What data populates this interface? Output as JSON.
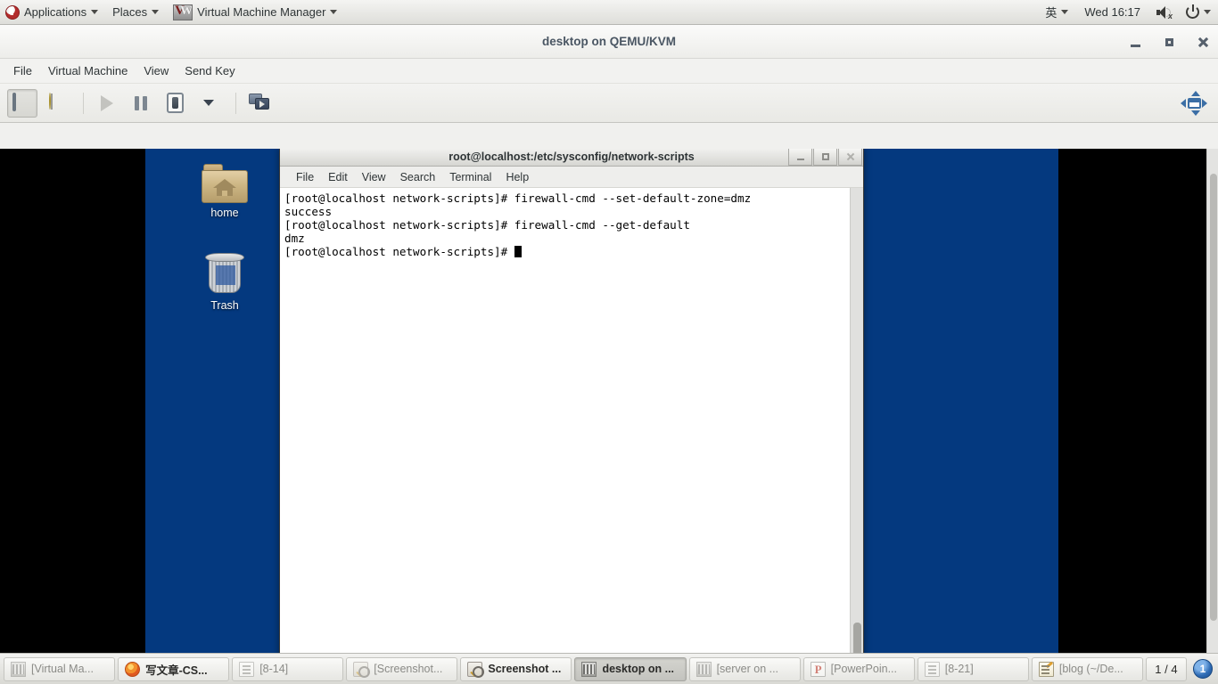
{
  "gnome_panel": {
    "menus": [
      {
        "label": "Applications",
        "icon": "fedora-logo-icon"
      },
      {
        "label": "Places",
        "icon": ""
      },
      {
        "label": "Virtual Machine Manager",
        "icon": "vmm-logo-icon"
      }
    ],
    "input_method": "英",
    "clock": "Wed 16:17",
    "volume_icon": "speaker-muted-icon",
    "power_icon": "power-icon"
  },
  "vmm_window": {
    "title": "desktop on QEMU/KVM",
    "window_buttons": {
      "minimize": "minimize",
      "maximize": "maximize",
      "close": "close"
    },
    "menus": [
      "File",
      "Virtual Machine",
      "View",
      "Send Key"
    ],
    "toolbar": [
      {
        "name": "show-console-button",
        "icon": "monitor-icon",
        "state": "active"
      },
      {
        "name": "show-details-button",
        "icon": "lightbulb-icon",
        "state": "normal"
      },
      {
        "name": "run-button",
        "icon": "play-icon",
        "state": "disabled"
      },
      {
        "name": "pause-button",
        "icon": "pause-icon",
        "state": "normal"
      },
      {
        "name": "shutdown-button",
        "icon": "shutdown-icon",
        "state": "normal"
      },
      {
        "name": "shutdown-menu-button",
        "icon": "caret-down-icon",
        "state": "normal"
      },
      {
        "name": "snapshots-button",
        "icon": "snapshots-icon",
        "state": "normal"
      }
    ],
    "resize_button_icon": "resize-to-vm-icon"
  },
  "vm_desktop": {
    "background_color": "#04397f",
    "icons": [
      {
        "label": "home",
        "icon": "home-folder-icon"
      },
      {
        "label": "Trash",
        "icon": "trash-icon"
      }
    ]
  },
  "terminal": {
    "title": "root@localhost:/etc/sysconfig/network-scripts",
    "window_buttons": {
      "minimize": "minimize",
      "maximize": "maximize",
      "close": "close"
    },
    "menus": [
      "File",
      "Edit",
      "View",
      "Search",
      "Terminal",
      "Help"
    ],
    "lines": [
      "[root@localhost network-scripts]# firewall-cmd --set-default-zone=dmz",
      "success",
      "[root@localhost network-scripts]# firewall-cmd --get-default",
      "dmz"
    ],
    "prompt": "[root@localhost network-scripts]# "
  },
  "taskbar": {
    "items": [
      {
        "label": "[Virtual Ma...",
        "icon": "vmm-window-icon",
        "active": false,
        "minimized": true
      },
      {
        "label": "写文章-CS...",
        "icon": "firefox-icon",
        "active": false,
        "minimized": false
      },
      {
        "label": "[8-14]",
        "icon": "document-icon",
        "active": false,
        "minimized": true
      },
      {
        "label": "[Screenshot...",
        "icon": "screenshot-icon",
        "active": false,
        "minimized": true
      },
      {
        "label": "Screenshot ...",
        "icon": "screenshot-icon",
        "active": true,
        "minimized": false
      },
      {
        "label": "desktop on ...",
        "icon": "vmm-window-icon",
        "active": true,
        "minimized": false
      },
      {
        "label": "[server on ...",
        "icon": "vmm-window-icon",
        "active": false,
        "minimized": true
      },
      {
        "label": "[PowerPoin...",
        "icon": "powerpoint-icon",
        "active": false,
        "minimized": true
      },
      {
        "label": "[8-21]",
        "icon": "document-icon",
        "active": false,
        "minimized": true
      },
      {
        "label": "[blog (~/De...",
        "icon": "notepad-icon",
        "active": false,
        "minimized": true
      }
    ],
    "workspace": "1 / 4",
    "notification_count": "1"
  }
}
